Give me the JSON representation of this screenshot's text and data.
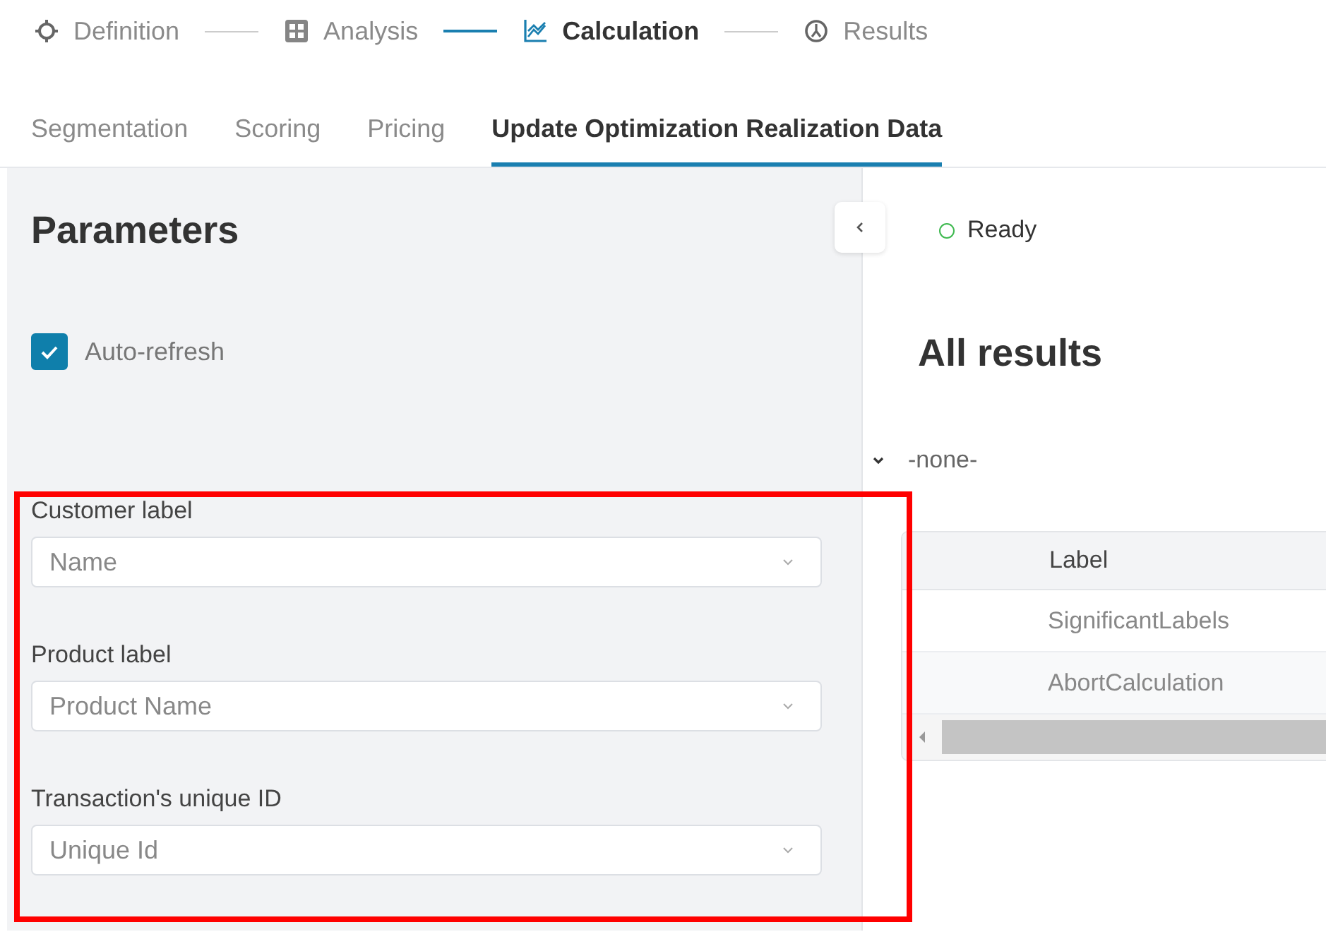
{
  "steps": [
    {
      "label": "Definition",
      "selected": false
    },
    {
      "label": "Analysis",
      "selected": false
    },
    {
      "label": "Calculation",
      "selected": true
    },
    {
      "label": "Results",
      "selected": false
    }
  ],
  "tabs": [
    {
      "label": "Segmentation",
      "selected": false
    },
    {
      "label": "Scoring",
      "selected": false
    },
    {
      "label": "Pricing",
      "selected": false
    },
    {
      "label": "Update Optimization Realization Data",
      "selected": true
    }
  ],
  "parameters": {
    "title": "Parameters",
    "auto_refresh": {
      "label": "Auto-refresh",
      "checked": true
    },
    "fields": [
      {
        "label": "Customer label",
        "value": "Name"
      },
      {
        "label": "Product label",
        "value": "Product Name"
      },
      {
        "label": "Transaction's unique ID",
        "value": "Unique Id"
      }
    ]
  },
  "annotation": {
    "kind": "highlight"
  },
  "results": {
    "status": "Ready",
    "title": "All results",
    "group": {
      "label": "-none-",
      "expanded": true
    },
    "table": {
      "columns": [
        "Label"
      ],
      "rows": [
        [
          "SignificantLabels"
        ],
        [
          "AbortCalculation"
        ]
      ]
    }
  }
}
